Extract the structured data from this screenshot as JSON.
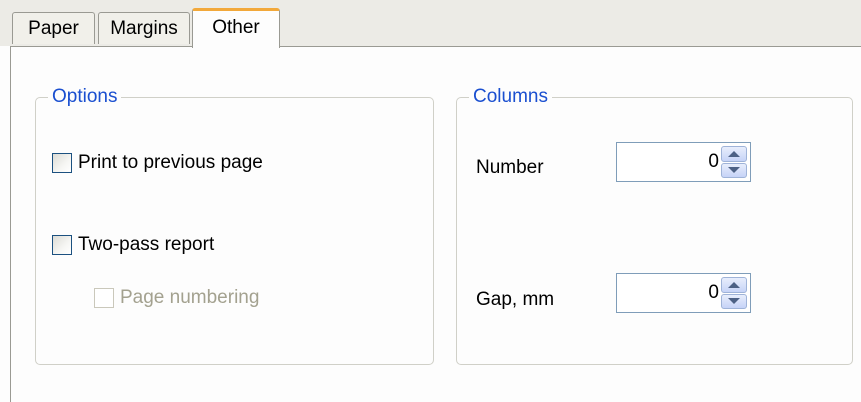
{
  "tabs": [
    {
      "label": "Paper",
      "active": false
    },
    {
      "label": "Margins",
      "active": false
    },
    {
      "label": "Other",
      "active": true
    }
  ],
  "options": {
    "title": "Options",
    "print_to_previous_page": {
      "label": "Print to previous page",
      "checked": false,
      "enabled": true
    },
    "two_pass_report": {
      "label": "Two-pass report",
      "checked": false,
      "enabled": true
    },
    "page_numbering": {
      "label": "Page numbering",
      "checked": false,
      "enabled": false
    }
  },
  "columns": {
    "title": "Columns",
    "number": {
      "label": "Number",
      "value": "0"
    },
    "gap": {
      "label": "Gap, mm",
      "value": "0"
    }
  },
  "colors": {
    "active_tab_accent": "#f2a83a",
    "group_title": "#1a4fd0",
    "disabled_text": "#a3a18f"
  }
}
